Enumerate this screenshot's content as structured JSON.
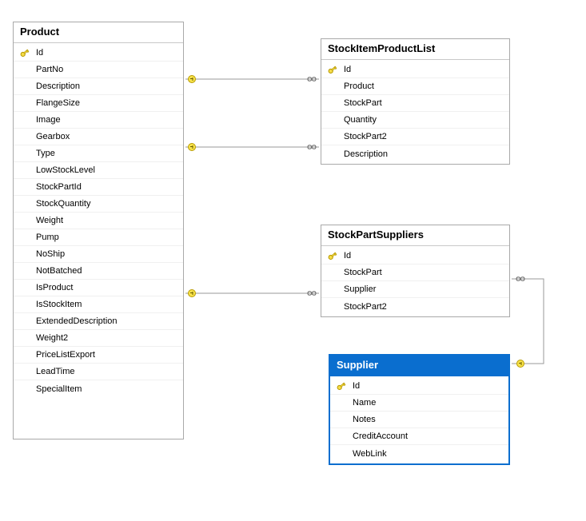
{
  "entities": {
    "product": {
      "title": "Product",
      "selected": false,
      "columns": [
        {
          "name": "Id",
          "pk": true
        },
        {
          "name": "PartNo",
          "pk": false
        },
        {
          "name": "Description",
          "pk": false
        },
        {
          "name": "FlangeSize",
          "pk": false
        },
        {
          "name": "Image",
          "pk": false
        },
        {
          "name": "Gearbox",
          "pk": false
        },
        {
          "name": "Type",
          "pk": false
        },
        {
          "name": "LowStockLevel",
          "pk": false
        },
        {
          "name": "StockPartId",
          "pk": false
        },
        {
          "name": "StockQuantity",
          "pk": false
        },
        {
          "name": "Weight",
          "pk": false
        },
        {
          "name": "Pump",
          "pk": false
        },
        {
          "name": "NoShip",
          "pk": false
        },
        {
          "name": "NotBatched",
          "pk": false
        },
        {
          "name": "IsProduct",
          "pk": false
        },
        {
          "name": "IsStockItem",
          "pk": false
        },
        {
          "name": "ExtendedDescription",
          "pk": false
        },
        {
          "name": "Weight2",
          "pk": false
        },
        {
          "name": "PriceListExport",
          "pk": false
        },
        {
          "name": "LeadTime",
          "pk": false
        },
        {
          "name": "SpecialItem",
          "pk": false
        }
      ]
    },
    "stockItemProductList": {
      "title": "StockItemProductList",
      "selected": false,
      "columns": [
        {
          "name": "Id",
          "pk": true
        },
        {
          "name": "Product",
          "pk": false
        },
        {
          "name": "StockPart",
          "pk": false
        },
        {
          "name": "Quantity",
          "pk": false
        },
        {
          "name": "StockPart2",
          "pk": false
        },
        {
          "name": "Description",
          "pk": false
        }
      ]
    },
    "stockPartSuppliers": {
      "title": "StockPartSuppliers",
      "selected": false,
      "columns": [
        {
          "name": "Id",
          "pk": true
        },
        {
          "name": "StockPart",
          "pk": false
        },
        {
          "name": "Supplier",
          "pk": false
        },
        {
          "name": "StockPart2",
          "pk": false
        }
      ]
    },
    "supplier": {
      "title": "Supplier",
      "selected": true,
      "columns": [
        {
          "name": "Id",
          "pk": true
        },
        {
          "name": "Name",
          "pk": false
        },
        {
          "name": "Notes",
          "pk": false
        },
        {
          "name": "CreditAccount",
          "pk": false
        },
        {
          "name": "WebLink",
          "pk": false
        }
      ]
    }
  },
  "colors": {
    "border": "#a9a9a9",
    "selected": "#0a6ecf",
    "line": "#9a9a9a"
  }
}
